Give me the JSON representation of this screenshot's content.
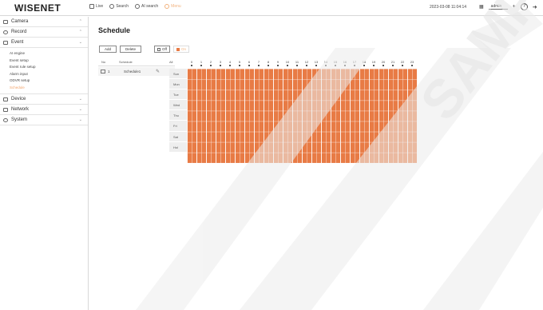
{
  "app": {
    "logo": "WISENET"
  },
  "topnav": [
    {
      "label": "Live",
      "icon": "monitor-icon",
      "enabled": true
    },
    {
      "label": "Search",
      "icon": "search-icon",
      "enabled": true
    },
    {
      "label": "AI search",
      "icon": "ai-search-icon",
      "enabled": true
    },
    {
      "label": "Menu",
      "icon": "menu-icon",
      "enabled": false
    }
  ],
  "header": {
    "datetime": "2023-03-08 11:04:14",
    "user": "admin"
  },
  "sidebar": {
    "camera": "Camera",
    "record": "Record",
    "event": "Event",
    "event_items": [
      "AI engine",
      "Event setup",
      "Event rule setup",
      "Alarm input",
      "ODVR setup",
      "Schedule"
    ],
    "device": "Device",
    "network": "Network",
    "system": "System"
  },
  "main": {
    "title": "Schedule",
    "add": "Add",
    "delete": "Delete",
    "off": "Off",
    "on": "On",
    "col_no": "No",
    "col_schedule": "Schedule",
    "row_no": "1",
    "row_name": "Schedule1",
    "hours_label": "All"
  },
  "schedule": {
    "hours": [
      "0",
      "1",
      "2",
      "3",
      "4",
      "5",
      "6",
      "7",
      "8",
      "9",
      "10",
      "11",
      "12",
      "13",
      "14",
      "15",
      "16",
      "17",
      "18",
      "19",
      "20",
      "21",
      "22",
      "23"
    ],
    "days": [
      "Sun",
      "Mon",
      "Tue",
      "Wed",
      "Thu",
      "Fri",
      "Sat",
      "Hol"
    ],
    "all_on": true,
    "on_color": "#e87b45"
  },
  "watermark": "SAMPLE"
}
